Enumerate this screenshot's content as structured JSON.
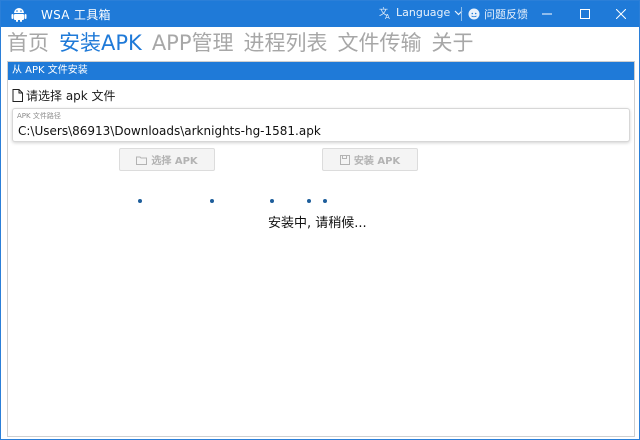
{
  "window": {
    "title": "WSA 工具箱",
    "language_label": "Language",
    "feedback_label": "问题反馈",
    "accent": "#1f7ad8"
  },
  "nav": {
    "items": [
      "首页",
      "安装APK",
      "APP管理",
      "进程列表",
      "文件传输",
      "关于"
    ],
    "active": "安装APK"
  },
  "panel": {
    "header": "从 APK 文件安装",
    "select_label": "请选择 apk 文件",
    "path_label": "APK 文件路径",
    "path_value": "C:\\Users\\86913\\Downloads\\arknights-hg-1581.apk",
    "select_button": "选择 APK",
    "install_button": "安装 APK",
    "status": "安装中, 请稍候..."
  },
  "icons": {
    "app": "android-icon",
    "language": "translate-icon",
    "feedback": "github-icon",
    "file": "file-icon",
    "folder": "folder-icon",
    "save": "save-icon"
  }
}
